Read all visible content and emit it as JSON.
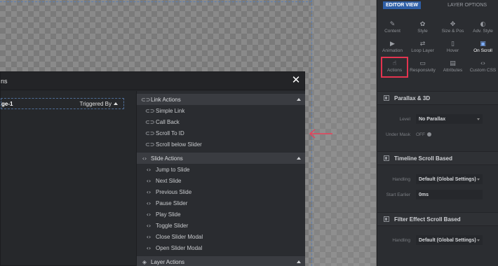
{
  "modal": {
    "title": "ns",
    "close_glyph": "✕",
    "trigger": {
      "name": "ge-1",
      "by_label": "Triggered By"
    },
    "sections": [
      {
        "title": "Link Actions",
        "icon": "link-icon",
        "items": [
          "Simple Link",
          "Call Back",
          "Scroll To ID",
          "Scroll below Slider"
        ]
      },
      {
        "title": "Slide Actions",
        "icon": "code-icon",
        "items": [
          "Jump to Slide",
          "Next Slide",
          "Previous Slide",
          "Pause Slider",
          "Play Slide",
          "Toggle Slider",
          "Close Slider Modal",
          "Open Slider Modal"
        ]
      },
      {
        "title": "Layer Actions",
        "icon": "layers-icon",
        "items": []
      }
    ]
  },
  "sidebar": {
    "tabs": {
      "editor": "EDITOR VIEW",
      "layer": "LAYER OPTIONS"
    },
    "grid": [
      [
        {
          "label": "Content",
          "icon": "pen-icon",
          "glyph": "✎"
        },
        {
          "label": "Style",
          "icon": "palette-icon",
          "glyph": "✿"
        },
        {
          "label": "Size & Pos",
          "icon": "move-icon",
          "glyph": "✥"
        },
        {
          "label": "Adv. Style",
          "icon": "contrast-icon",
          "glyph": "◐"
        }
      ],
      [
        {
          "label": "Animation",
          "icon": "play-icon",
          "glyph": "▶"
        },
        {
          "label": "Loop Layer",
          "icon": "loop-icon",
          "glyph": "⇄"
        },
        {
          "label": "Hover",
          "icon": "mouse-icon",
          "glyph": "▯"
        },
        {
          "label": "On Scroll",
          "icon": "scroll-icon",
          "glyph": "▣",
          "active": true
        }
      ],
      [
        {
          "label": "Actions",
          "icon": "hand-icon",
          "glyph": "☝",
          "boxed": true
        },
        {
          "label": "Responsivity",
          "icon": "monitor-icon",
          "glyph": "▭"
        },
        {
          "label": "Attributes",
          "icon": "document-icon",
          "glyph": "▤"
        },
        {
          "label": "Custom CSS",
          "icon": "code-brackets-icon",
          "glyph": "‹›"
        }
      ]
    ],
    "panels": [
      {
        "title": "Parallax & 3D",
        "fields": [
          {
            "label": "Level",
            "value": "No Parallax",
            "type": "select"
          },
          {
            "label": "Under Mask",
            "value": "OFF",
            "type": "toggle"
          }
        ]
      },
      {
        "title": "Timeline Scroll Based",
        "fields": [
          {
            "label": "Handling",
            "value": "Default (Global Settings)",
            "type": "select"
          },
          {
            "label": "Start Earlier",
            "value": "0ms",
            "type": "text"
          }
        ]
      },
      {
        "title": "Filter Effect Scroll Based",
        "fields": [
          {
            "label": "Handling",
            "value": "Default (Global Settings)",
            "type": "select"
          }
        ]
      }
    ]
  },
  "colors": {
    "accent": "#2f5fa6",
    "highlight_box": "#e3344f",
    "arrow": "#e8415a"
  }
}
